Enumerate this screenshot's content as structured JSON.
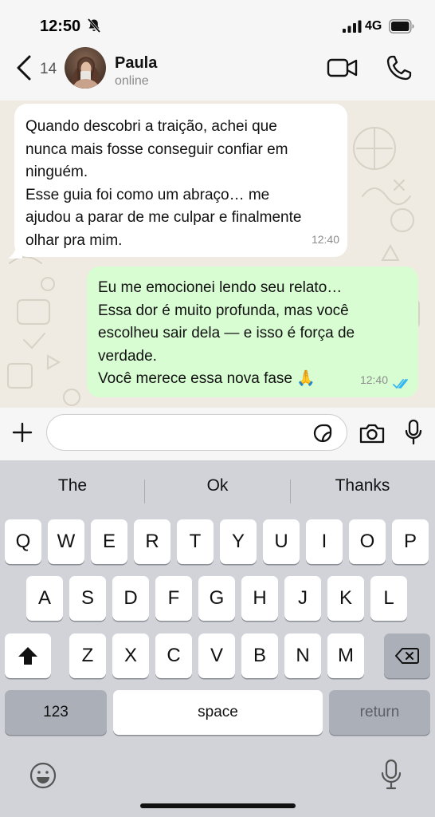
{
  "status_bar": {
    "time": "12:50",
    "network": "4G",
    "icons": [
      "bell-muted-icon",
      "signal-icon",
      "battery-icon"
    ]
  },
  "header": {
    "back_count": "14",
    "contact_name": "Paula",
    "contact_status": "online",
    "icons": [
      "chevron-left-icon",
      "video-call-icon",
      "phone-icon"
    ]
  },
  "messages": [
    {
      "direction": "incoming",
      "text": "Quando descobri a traição, achei que\nnunca mais fosse conseguir confiar em\nninguém.\nEsse guia foi como um abraço… me\najudou a parar de me culpar e finalmente\nolhar pra mim.",
      "time": "12:40"
    },
    {
      "direction": "outgoing",
      "text": "Eu me emocionei lendo seu relato…\nEssa dor é muito profunda, mas você\nescolheu sair dela — e isso é força de\nverdade.\nVocê merece essa nova fase 🙏",
      "time": "12:40",
      "status": "read",
      "status_icon": "double-check-icon"
    }
  ],
  "input_bar": {
    "placeholder": "",
    "value": "",
    "icons": [
      "plus-icon",
      "sticker-icon",
      "camera-icon",
      "microphone-icon"
    ]
  },
  "keyboard": {
    "suggestions": [
      "The",
      "Ok",
      "Thanks"
    ],
    "row1": [
      "Q",
      "W",
      "E",
      "R",
      "T",
      "Y",
      "U",
      "I",
      "O",
      "P"
    ],
    "row2": [
      "A",
      "S",
      "D",
      "F",
      "G",
      "H",
      "J",
      "K",
      "L"
    ],
    "row3": [
      "Z",
      "X",
      "C",
      "V",
      "B",
      "N",
      "M"
    ],
    "numbers_label": "123",
    "space_label": "space",
    "return_label": "return",
    "icons": [
      "shift-icon",
      "backspace-icon",
      "emoji-icon",
      "dictation-icon"
    ]
  },
  "colors": {
    "outgoing_bubble": "#d9fdd3",
    "incoming_bubble": "#ffffff",
    "chat_background": "#efeae2",
    "read_ticks": "#34b7f1",
    "keyboard_background": "#d1d3d9"
  }
}
